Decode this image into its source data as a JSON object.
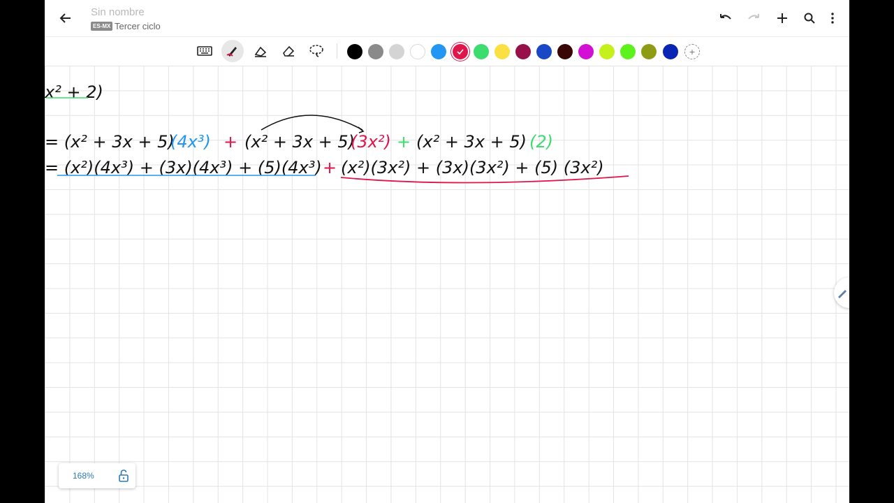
{
  "header": {
    "title": "Sin nombre",
    "language_badge": "ES-MX",
    "notebook": "Tercer ciclo",
    "icons": [
      "back-arrow-icon",
      "undo-icon",
      "redo-icon",
      "add-icon",
      "search-icon",
      "more-vertical-icon"
    ]
  },
  "toolbar": {
    "tools": [
      "keyboard-icon",
      "pen-icon",
      "highlighter-icon",
      "eraser-icon",
      "lasso-icon"
    ],
    "active_tool": "pen",
    "colors": [
      "#000000",
      "#8a8a8a",
      "#d4d4d4",
      "#ffffff",
      "#2196f3",
      "#e0154a",
      "#3ddc6f",
      "#fbe043",
      "#98104a",
      "#1848c5",
      "#3a0505",
      "#d20fd2",
      "#c6f01c",
      "#5ef21c",
      "#8e9c15",
      "#0a24b3"
    ],
    "selected_color": "#e0154a"
  },
  "ink": {
    "line0": "x² + 2)",
    "line1_a": "= (x² + 3x + 5)",
    "line1_b": "(4x³)",
    "line1_c": "+",
    "line1_d": "(x² + 3x + 5)",
    "line1_e": "(3x²)",
    "line1_f": "+",
    "line1_g": "(x² + 3x + 5)",
    "line1_h": "(2)",
    "line2_a": "= (x²)(4x³) + (3x)(4x³) + (5)(4x³)",
    "line2_b": "+",
    "line2_c": "(x²)(3x²) + (3x)(3x²) + (5) (3x²)"
  },
  "footer": {
    "zoom": "168%"
  }
}
